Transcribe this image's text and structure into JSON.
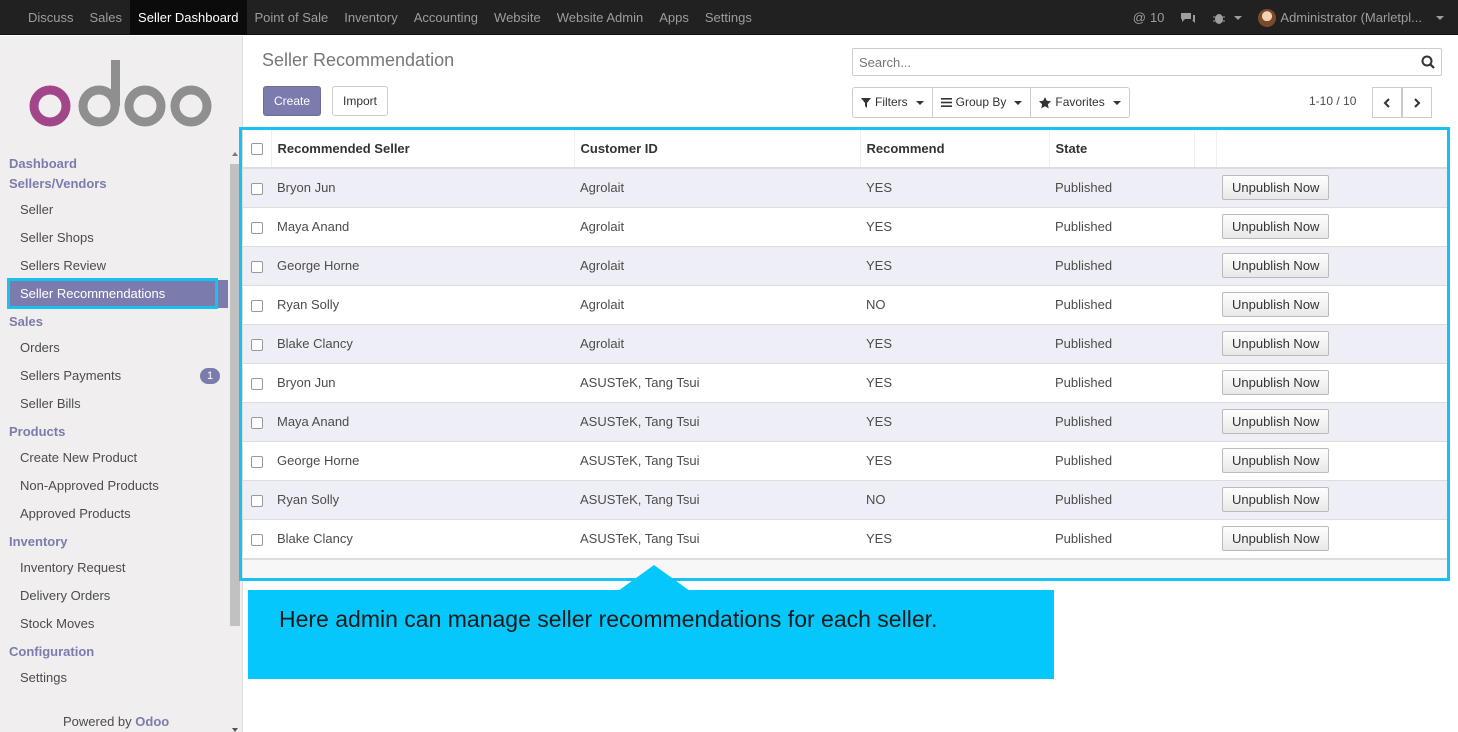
{
  "topbar": {
    "nav": [
      "Discuss",
      "Sales",
      "Seller Dashboard",
      "Point of Sale",
      "Inventory",
      "Accounting",
      "Website",
      "Website Admin",
      "Apps",
      "Settings"
    ],
    "active": "Seller Dashboard",
    "mentions_count": "10",
    "user": "Administrator (Marletpl..."
  },
  "sidebar": {
    "logo": "odoo",
    "sections": [
      {
        "title": "Dashboard"
      },
      {
        "title": "Sellers/Vendors",
        "items": [
          "Seller",
          "Seller Shops",
          "Sellers Review",
          "Seller Recommendations"
        ]
      },
      {
        "title": "Sales",
        "items": [
          "Orders",
          "Sellers Payments",
          "Seller Bills"
        ]
      },
      {
        "title": "Products",
        "items": [
          "Create New Product",
          "Non-Approved Products",
          "Approved Products"
        ]
      },
      {
        "title": "Inventory",
        "items": [
          "Inventory Request",
          "Delivery Orders",
          "Stock Moves"
        ]
      },
      {
        "title": "Configuration",
        "items": [
          "Settings"
        ]
      }
    ],
    "active_item": "Seller Recommendations",
    "payments_badge": "1",
    "powered_by_prefix": "Powered by",
    "powered_by_brand": "Odoo"
  },
  "control": {
    "title": "Seller Recommendation",
    "create_label": "Create",
    "import_label": "Import",
    "search_placeholder": "Search...",
    "filters_label": "Filters",
    "groupby_label": "Group By",
    "favorites_label": "Favorites",
    "pager": "1-10 / 10"
  },
  "table": {
    "columns": [
      "Recommended Seller",
      "Customer ID",
      "Recommend",
      "State"
    ],
    "action_label": "Unpublish Now",
    "rows": [
      {
        "seller": "Bryon Jun",
        "customer": "Agrolait",
        "recommend": "YES",
        "state": "Published"
      },
      {
        "seller": "Maya Anand",
        "customer": "Agrolait",
        "recommend": "YES",
        "state": "Published"
      },
      {
        "seller": "George Horne",
        "customer": "Agrolait",
        "recommend": "YES",
        "state": "Published"
      },
      {
        "seller": "Ryan Solly",
        "customer": "Agrolait",
        "recommend": "NO",
        "state": "Published"
      },
      {
        "seller": "Blake Clancy",
        "customer": "Agrolait",
        "recommend": "YES",
        "state": "Published"
      },
      {
        "seller": "Bryon Jun",
        "customer": "ASUSTeK, Tang Tsui",
        "recommend": "YES",
        "state": "Published"
      },
      {
        "seller": "Maya Anand",
        "customer": "ASUSTeK, Tang Tsui",
        "recommend": "YES",
        "state": "Published"
      },
      {
        "seller": "George Horne",
        "customer": "ASUSTeK, Tang Tsui",
        "recommend": "YES",
        "state": "Published"
      },
      {
        "seller": "Ryan Solly",
        "customer": "ASUSTeK, Tang Tsui",
        "recommend": "NO",
        "state": "Published"
      },
      {
        "seller": "Blake Clancy",
        "customer": "ASUSTeK, Tang Tsui",
        "recommend": "YES",
        "state": "Published"
      }
    ]
  },
  "callout": {
    "text": "Here admin can manage seller recommendations for each seller."
  },
  "colors": {
    "accent": "#7c7bad",
    "highlight": "#17c2f0",
    "callout": "#05c7fb",
    "topbar": "#212121"
  }
}
